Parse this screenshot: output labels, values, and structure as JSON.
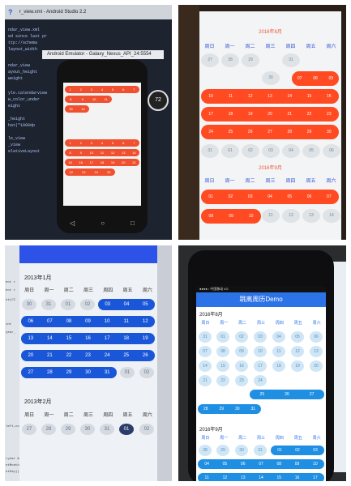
{
  "panel1": {
    "ide_title": "r_view.xml - Android Studio 2.2",
    "ide_help": "?",
    "emulator_title": "Android Emulator - Galaxy_Nexus_API_24:5554",
    "badge": "72",
    "code_lines": [
      "ndar_view.xml",
      "ed since last pr",
      "ttp://schema",
      "layout_width",
      "ndar_view",
      "ayout_height",
      "weight",
      "yle.calendarview",
      "w_color_under",
      "eight",
      "_height",
      "hat(\"1000dp",
      "le_view",
      "_view",
      "elativeLayout"
    ],
    "nav_icons": [
      "◁",
      "○",
      "□"
    ]
  },
  "panel2": {
    "month_title_1": "2016年8月",
    "month_title_2": "2016年9月",
    "weekdays": [
      "周日",
      "周一",
      "周二",
      "周三",
      "周四",
      "周五",
      "周六"
    ],
    "m1_row1": [
      "27",
      "28",
      "29",
      "30",
      "31"
    ],
    "m1_row1_band": [
      "07",
      "08",
      "09"
    ],
    "m1_band_rows": [
      [
        "10",
        "11",
        "12",
        "13",
        "14",
        "15",
        "16"
      ],
      [
        "17",
        "18",
        "19",
        "20",
        "21",
        "22",
        "23"
      ],
      [
        "24",
        "25",
        "26",
        "27",
        "28",
        "29",
        "30"
      ]
    ],
    "m1_tail": [
      "31",
      "01",
      "02",
      "03",
      "04",
      "05",
      "06"
    ],
    "m2_row1_band": [
      "01",
      "02",
      "03",
      "04",
      "05",
      "06",
      "07"
    ],
    "m2_row2_band": [
      "08",
      "09",
      "10"
    ],
    "m2_row2_rest": [
      "11",
      "12",
      "13",
      "14"
    ]
  },
  "panel3": {
    "month_1": "2013年1月",
    "month_2": "2013年2月",
    "weekdays": [
      "周日",
      "周一",
      "周二",
      "周三",
      "周四",
      "周五",
      "周六"
    ],
    "row1_plain": [
      "30",
      "31",
      "01",
      "02"
    ],
    "row1_band": [
      "03",
      "04",
      "05"
    ],
    "band_rows": [
      [
        "06",
        "07",
        "08",
        "09",
        "10",
        "11",
        "12"
      ],
      [
        "13",
        "14",
        "15",
        "16",
        "17",
        "18",
        "19"
      ],
      [
        "20",
        "21",
        "22",
        "23",
        "24",
        "25",
        "26"
      ]
    ],
    "last_band": [
      "27",
      "28",
      "29",
      "30",
      "31"
    ],
    "last_plain": [
      "01",
      "02"
    ],
    "feb_row": [
      "27",
      "28",
      "29",
      "30",
      "31",
      "01",
      "02"
    ],
    "code_lines": [
      "ect r",
      "ect r",
      "nt(CC",
      "int",
      "year_",
      "left,const SDerow right)",
      "ryear &&",
      "ntMonth &&",
      "ntDay)("
    ]
  },
  "panel4": {
    "status": "●●●●○ 中国移动 4G",
    "app_title": "跳离周历Demo",
    "month_1": "2016年8月",
    "month_2": "2016年9月",
    "weekdays": [
      "周日",
      "周一",
      "周二",
      "周三",
      "周四",
      "周五",
      "周六"
    ],
    "row1": [
      "31",
      "01",
      "02",
      "03",
      "04",
      "05",
      "06"
    ],
    "row2": [
      "07",
      "08",
      "09",
      "10",
      "11",
      "12",
      "13"
    ],
    "row3": [
      "14",
      "15",
      "16",
      "17",
      "18",
      "19",
      "20"
    ],
    "row4_plain": [
      "21",
      "22",
      "23",
      "24"
    ],
    "row4_band": [
      "25",
      "26",
      "27"
    ],
    "row5_band": [
      "28",
      "29",
      "30",
      "31"
    ],
    "sep_row1_plain": [
      "28",
      "29",
      "30",
      "31"
    ],
    "sep_row1_band": [
      "01",
      "02",
      "03"
    ],
    "sep_row2_band": [
      "04",
      "05",
      "06",
      "07",
      "08",
      "09",
      "10"
    ],
    "sep_row3_band": [
      "11",
      "12",
      "13",
      "14",
      "15",
      "16",
      "17"
    ]
  }
}
